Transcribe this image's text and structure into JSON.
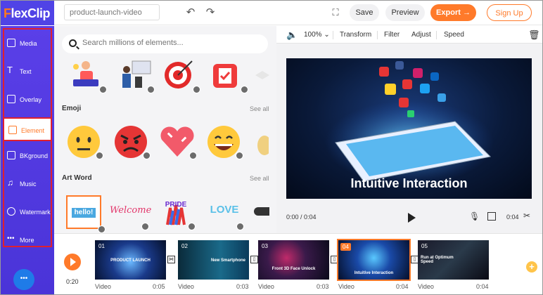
{
  "app": {
    "logo_first": "F",
    "logo_rest": "lexClip",
    "project_name": "product-launch-video"
  },
  "header": {
    "save_label": "Save",
    "preview_label": "Preview",
    "export_label": "Export →",
    "signup_label": "Sign Up"
  },
  "sidebar": {
    "items": [
      {
        "label": "Media",
        "icon": "media-icon"
      },
      {
        "label": "Text",
        "icon": "text-icon"
      },
      {
        "label": "Overlay",
        "icon": "overlay-icon"
      },
      {
        "label": "Element",
        "icon": "element-icon",
        "active": true
      },
      {
        "label": "BKground",
        "icon": "background-icon"
      },
      {
        "label": "Music",
        "icon": "music-icon"
      },
      {
        "label": "Watermark",
        "icon": "watermark-icon"
      },
      {
        "label": "More",
        "icon": "more-icon"
      }
    ]
  },
  "panel": {
    "search_placeholder": "Search millions of elements...",
    "sections": [
      {
        "title": "Emoji",
        "see_all": "See all"
      },
      {
        "title": "Art Word",
        "see_all": "See all"
      }
    ],
    "art_words": [
      "hello!",
      "Welcome",
      "PRIDE",
      "LOVE"
    ]
  },
  "toolbar": {
    "zoom": "100%",
    "transform": "Transform",
    "filter": "Filter",
    "adjust": "Adjust",
    "speed": "Speed"
  },
  "stage": {
    "title": "Intuitive Interaction"
  },
  "playbar": {
    "current": "0:00 / 0:04",
    "duration": "0:04"
  },
  "timeline": {
    "total": "0:20",
    "clips": [
      {
        "num": "01",
        "caption": "PRODUCT LAUNCH",
        "type": "Video",
        "duration": "0:05"
      },
      {
        "num": "02",
        "caption": "New Smartphone",
        "type": "Video",
        "duration": "0:03"
      },
      {
        "num": "03",
        "caption": "Front 3D Face Unlock",
        "type": "Video",
        "duration": "0:03"
      },
      {
        "num": "04",
        "caption": "Intuitive Interaction",
        "type": "Video",
        "duration": "0:04",
        "selected": true
      },
      {
        "num": "05",
        "caption": "Run at Optimum Speed",
        "type": "Video",
        "duration": "0:04"
      }
    ]
  },
  "colors": {
    "accent": "#ff7a2a",
    "sidebar": "#5043e6",
    "highlight": "#e0202e"
  }
}
